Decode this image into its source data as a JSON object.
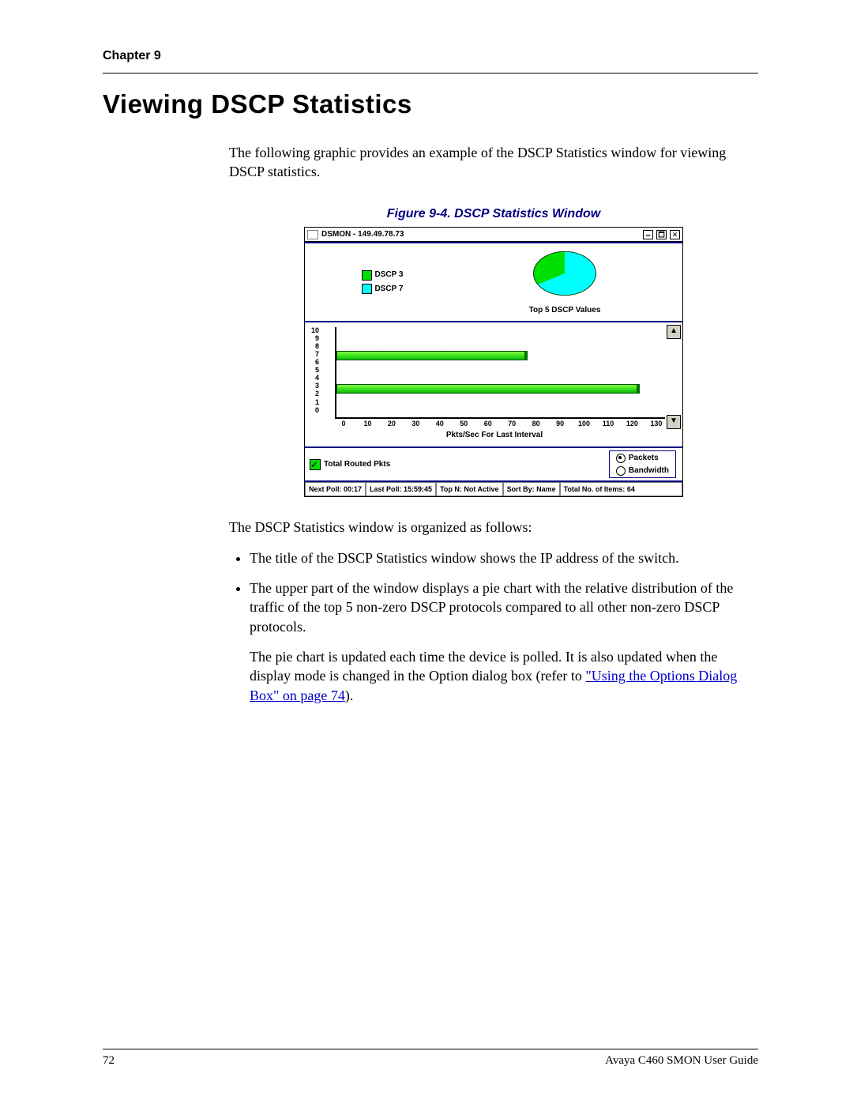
{
  "chapter": "Chapter 9",
  "title": "Viewing DSCP Statistics",
  "intro": "The following graphic provides an example of the DSCP Statistics window for viewing DSCP statistics.",
  "figure_caption": "Figure 9-4.  DSCP Statistics Window",
  "after_fig": "The DSCP Statistics window is organized as follows:",
  "bullets": {
    "b1": "The title of the DSCP Statistics window shows the IP address of the switch.",
    "b2": "The upper part of the window displays a pie chart with the relative distribution of the traffic of the top 5 non-zero DSCP protocols compared to all other non-zero DSCP protocols.",
    "b2_p2_a": "The pie chart is updated each time the device is polled. It is also updated when the display mode is changed in the Option dialog box (refer to ",
    "b2_link": "\"Using the Options Dialog Box\" on page 74",
    "b2_p2_b": ")."
  },
  "footer": {
    "page": "72",
    "guide": "Avaya C460 SMON User Guide"
  },
  "window": {
    "title": "DSMON - 149.49.78.73",
    "legend": {
      "a": "DSCP 3",
      "b": "DSCP 7"
    },
    "pie_caption": "Top 5 DSCP Values",
    "bar_caption": "Pkts/Sec For Last Interval",
    "checkbox_label": "Total Routed Pkts",
    "radio_packets": "Packets",
    "radio_bandwidth": "Bandwidth",
    "status": {
      "next": "Next Poll:  00:17",
      "last": "Last Poll:  15:59:45",
      "topn": "Top N: Not Active",
      "sort": "Sort By: Name",
      "items": "Total No. of Items: 64"
    }
  },
  "chart_data": [
    {
      "type": "pie",
      "title": "Top 5 DSCP Values",
      "series": [
        {
          "name": "DSCP 7",
          "value": 68,
          "color": "#00ffff"
        },
        {
          "name": "DSCP 3",
          "value": 32,
          "color": "#00e000"
        }
      ]
    },
    {
      "type": "bar",
      "orientation": "horizontal",
      "xlabel": "Pkts/Sec For Last Interval",
      "ylabel": "",
      "categories": [
        0,
        1,
        2,
        3,
        4,
        5,
        6,
        7,
        8,
        9,
        10
      ],
      "x_ticks": [
        0,
        10,
        20,
        30,
        40,
        50,
        60,
        70,
        80,
        90,
        100,
        110,
        120,
        130
      ],
      "xlim": [
        0,
        140
      ],
      "ylim": [
        0,
        10
      ],
      "series": [
        {
          "name": "DSCP 7",
          "y": 7,
          "value": 80,
          "color": "#00e000"
        },
        {
          "name": "DSCP 3",
          "y": 3,
          "value": 128,
          "color": "#00e000"
        }
      ]
    }
  ],
  "icons": {
    "minimize": "🗕",
    "maximize": "🗖",
    "close": "✕",
    "up": "▲",
    "down": "▼"
  }
}
